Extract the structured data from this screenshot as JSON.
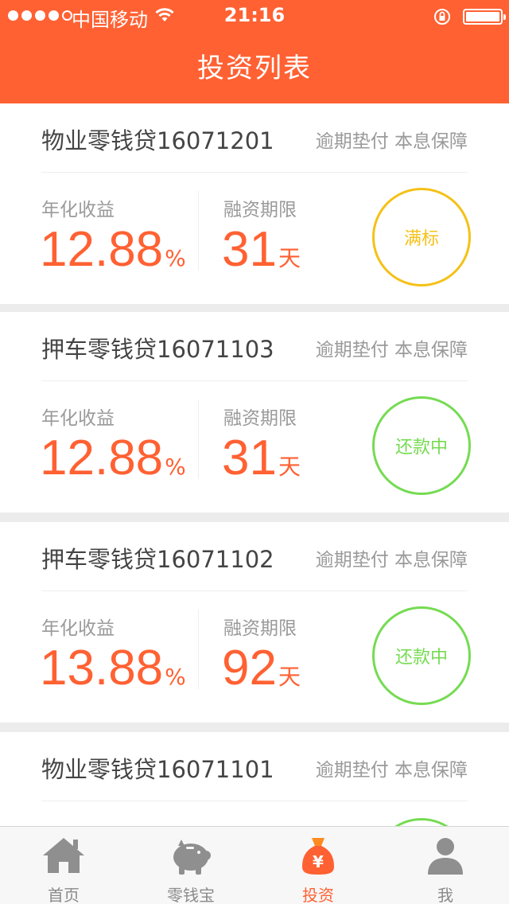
{
  "status_bar": {
    "carrier": "中国移动",
    "time": "21:16"
  },
  "header": {
    "title": "投资列表"
  },
  "colors": {
    "brand": "#ff6133",
    "full_status": "#f5c117",
    "repaying_status": "#75db52"
  },
  "labels": {
    "rate": "年化收益",
    "term": "融资期限",
    "tags": "逾期垫付 本息保障",
    "percent_unit": "%",
    "day_unit": "天"
  },
  "cards": [
    {
      "title": "物业零钱贷16071201",
      "rate": "12.88",
      "term": "31",
      "status": "满标"
    },
    {
      "title": "押车零钱贷16071103",
      "rate": "12.88",
      "term": "31",
      "status": "还款中"
    },
    {
      "title": "押车零钱贷16071102",
      "rate": "13.88",
      "term": "92",
      "status": "还款中"
    },
    {
      "title": "物业零钱贷16071101"
    }
  ],
  "tabbar": {
    "items": [
      {
        "label": "首页",
        "icon": "home-icon"
      },
      {
        "label": "零钱宝",
        "icon": "piggy-bank-icon"
      },
      {
        "label": "投资",
        "icon": "money-bag-icon"
      },
      {
        "label": "我",
        "icon": "user-icon"
      }
    ],
    "active": "投资"
  }
}
